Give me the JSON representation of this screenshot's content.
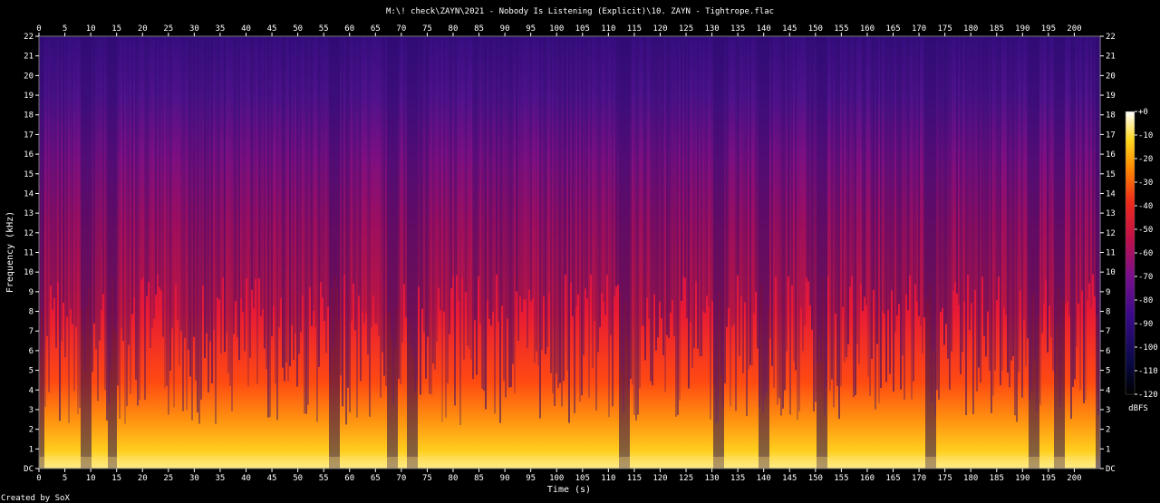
{
  "chart_data": {
    "type": "heatmap",
    "title": "M:\\! check\\ZAYN\\2021 - Nobody Is Listening (Explicit)\\10. ZAYN - Tightrope.flac",
    "xlabel": "Time (s)",
    "ylabel": "Frequency (kHz)",
    "xlim": [
      0,
      205
    ],
    "ylim": [
      0,
      22
    ],
    "x_ticks": [
      "0",
      "5",
      "10",
      "15",
      "20",
      "25",
      "30",
      "35",
      "40",
      "45",
      "50",
      "55",
      "60",
      "65",
      "70",
      "75",
      "80",
      "85",
      "90",
      "95",
      "100",
      "105",
      "110",
      "115",
      "120",
      "125",
      "130",
      "135",
      "140",
      "145",
      "150",
      "155",
      "160",
      "165",
      "170",
      "175",
      "180",
      "185",
      "190",
      "195",
      "200"
    ],
    "y_ticks": [
      "DC",
      "1",
      "2",
      "3",
      "4",
      "5",
      "6",
      "7",
      "8",
      "9",
      "10",
      "11",
      "12",
      "13",
      "14",
      "15",
      "16",
      "17",
      "18",
      "19",
      "20",
      "21",
      "22"
    ],
    "colorbar": {
      "label": "dBFS",
      "ticks": [
        "+0",
        "-10",
        "-20",
        "-30",
        "-40",
        "-50",
        "-60",
        "-70",
        "-80",
        "-90",
        "-100",
        "-110",
        "-120"
      ],
      "range": [
        -120,
        0
      ]
    },
    "track_end_s": 204,
    "energy_dips_s": [
      0,
      9,
      14,
      57,
      68,
      72,
      113,
      131,
      140,
      151,
      172,
      192,
      197
    ]
  },
  "footer": "Created by SoX"
}
